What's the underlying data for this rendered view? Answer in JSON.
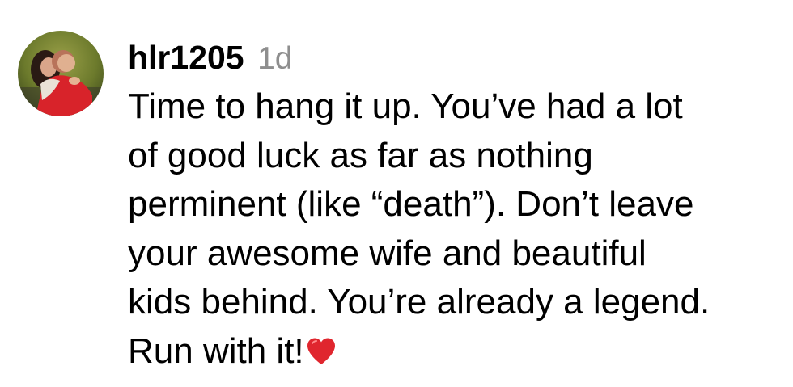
{
  "comment": {
    "avatar_icon": "profile-photo-couple-hugging",
    "username": "hlr1205",
    "time_ago": "1d",
    "text_lines": [
      "Time to hang it up. You’ve had a lot",
      "of good luck as far as nothing",
      "perminent (like “death”). Don’t leave",
      "your awesome wife and beautiful",
      "kids behind. You’re already a legend.",
      "Run with it!"
    ],
    "emoji": "red-heart-icon",
    "colors": {
      "text": "#000000",
      "timestamp": "#8e8e8e",
      "heart": "#e0262e"
    }
  }
}
